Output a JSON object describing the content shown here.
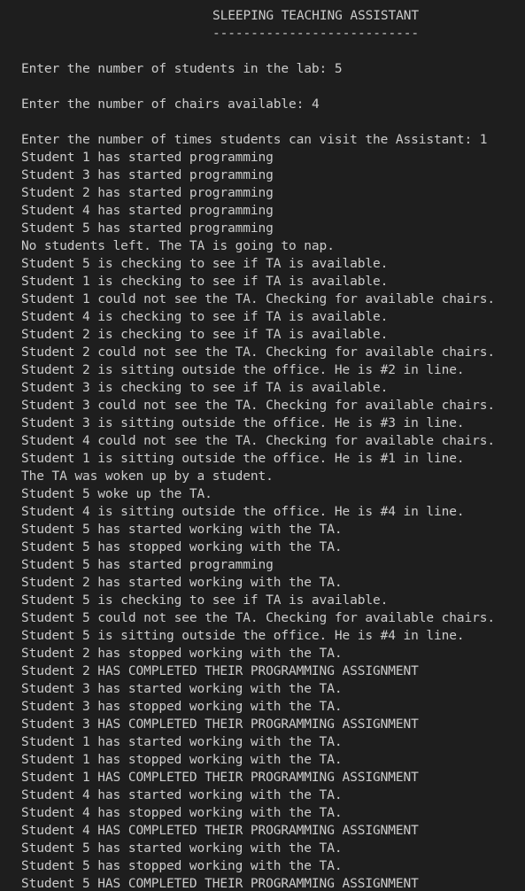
{
  "header": {
    "title": "SLEEPING TEACHING ASSISTANT",
    "underline": "---------------------------"
  },
  "prompts": [
    {
      "label": "Enter the number of students in the lab:",
      "value": "5"
    },
    {
      "label": "Enter the number of chairs available:",
      "value": "4"
    },
    {
      "label": "Enter the number of times students can visit the Assistant:",
      "value": "1"
    }
  ],
  "output_lines": [
    "Student 1 has started programming",
    "Student 3 has started programming",
    "Student 2 has started programming",
    "Student 4 has started programming",
    "Student 5 has started programming",
    "No students left. The TA is going to nap.",
    "Student 5 is checking to see if TA is available.",
    "Student 1 is checking to see if TA is available.",
    "Student 1 could not see the TA. Checking for available chairs.",
    "Student 4 is checking to see if TA is available.",
    "Student 2 is checking to see if TA is available.",
    "Student 2 could not see the TA. Checking for available chairs.",
    "Student 2 is sitting outside the office. He is #2 in line.",
    "Student 3 is checking to see if TA is available.",
    "Student 3 could not see the TA. Checking for available chairs.",
    "Student 3 is sitting outside the office. He is #3 in line.",
    "Student 4 could not see the TA. Checking for available chairs.",
    "Student 1 is sitting outside the office. He is #1 in line.",
    "The TA was woken up by a student.",
    "Student 5 woke up the TA.",
    "Student 4 is sitting outside the office. He is #4 in line.",
    "Student 5 has started working with the TA.",
    "Student 5 has stopped working with the TA.",
    "Student 5 has started programming",
    "Student 2 has started working with the TA.",
    "Student 5 is checking to see if TA is available.",
    "Student 5 could not see the TA. Checking for available chairs.",
    "Student 5 is sitting outside the office. He is #4 in line.",
    "Student 2 has stopped working with the TA.",
    "Student 2 HAS COMPLETED THEIR PROGRAMMING ASSIGNMENT",
    "Student 3 has started working with the TA.",
    "Student 3 has stopped working with the TA.",
    "Student 3 HAS COMPLETED THEIR PROGRAMMING ASSIGNMENT",
    "Student 1 has started working with the TA.",
    "Student 1 has stopped working with the TA.",
    "Student 1 HAS COMPLETED THEIR PROGRAMMING ASSIGNMENT",
    "Student 4 has started working with the TA.",
    "Student 4 has stopped working with the TA.",
    "Student 4 HAS COMPLETED THEIR PROGRAMMING ASSIGNMENT",
    "Student 5 has started working with the TA.",
    "Student 5 has stopped working with the TA.",
    "Student 5 HAS COMPLETED THEIR PROGRAMMING ASSIGNMENT"
  ],
  "colors": {
    "background": "#1e1e1e",
    "text": "#cccccc"
  }
}
